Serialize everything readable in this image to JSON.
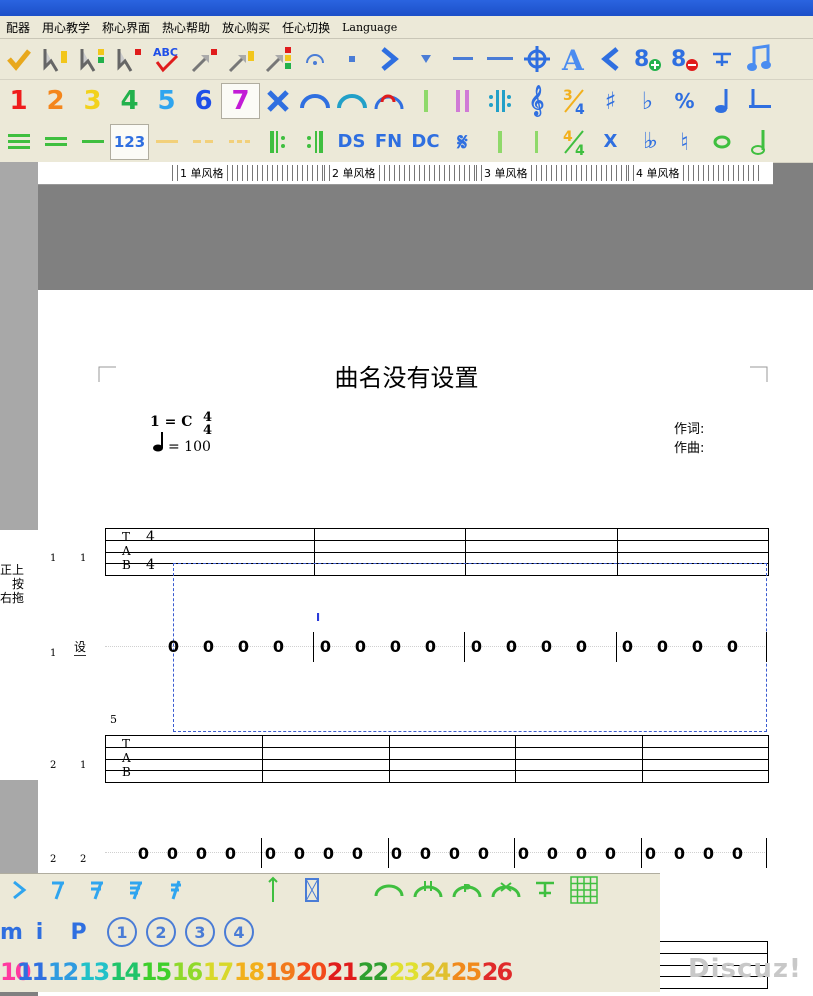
{
  "menu": [
    "配器",
    "用心教学",
    "称心界面",
    "热心帮助",
    "放心购买",
    "任心切换",
    "Language"
  ],
  "toolbar2_numbers": [
    "1",
    "2",
    "3",
    "4",
    "5",
    "6",
    "7"
  ],
  "toolbar3_text": {
    "num": "123",
    "ds": "DS",
    "fn": "FN",
    "dc": "DC",
    "x": "X"
  },
  "ruler": [
    "1 单风格",
    "2 单风格",
    "3 单风格",
    "4 单风格"
  ],
  "score": {
    "title": "曲名没有设置",
    "key": "1 = C",
    "time_top": "4",
    "time_bottom": "4",
    "tempo": "= 100",
    "lyricist": "作词:",
    "composer": "作曲:",
    "measure_number": "5",
    "cursor": "I",
    "row1_label_a": "1",
    "row1_label_b": "1",
    "row1_jp_label": "1",
    "row2_label_a": "2",
    "row2_label_b": "1",
    "row2_jp_label_a": "2",
    "row2_jp_label_b": "2",
    "tab_t": "T",
    "tab_a": "A",
    "tab_b": "B",
    "tab_four": "4",
    "jp_note": "0",
    "side_text": [
      "正上",
      "按",
      "右拖"
    ],
    "side_label": "设"
  },
  "palette_circles": [
    "1",
    "2",
    "3",
    "4"
  ],
  "palette_p2": {
    "m": "m",
    "i": "i",
    "p": "P"
  },
  "palette_numbers": [
    "10",
    "11",
    "12",
    "13",
    "14",
    "15",
    "16",
    "17",
    "18",
    "19",
    "20",
    "21",
    "22",
    "23",
    "24",
    "25",
    "26"
  ],
  "palette_number_colors": [
    "#ff3aa0",
    "#2f6fe0",
    "#2f9be0",
    "#22c1c8",
    "#20c46a",
    "#3fcf2b",
    "#8fd92b",
    "#d8d82a",
    "#f2b01c",
    "#f27a1c",
    "#f24a1c",
    "#e01c1c",
    "#2f9f2f",
    "#e0e030",
    "#e0c030",
    "#f08a1c",
    "#e02a2a",
    "#e01c1c"
  ],
  "toolbar_number_colors": [
    "#ef1c1c",
    "#f4861c",
    "#f2d21c",
    "#22b14c",
    "#2fa5ef",
    "#1f4fe8",
    "#c21cd6"
  ],
  "watermark": "Discuz!"
}
